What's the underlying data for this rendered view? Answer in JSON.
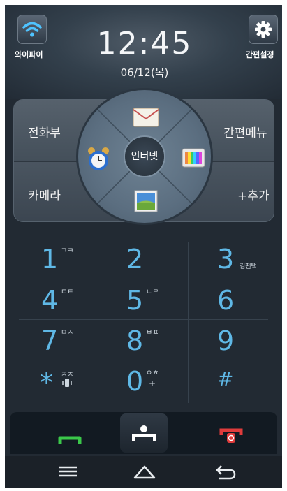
{
  "status": {
    "time": "12:45",
    "date": "06/12(목)"
  },
  "header": {
    "wifi_label": "와이파이",
    "settings_label": "간편설정"
  },
  "quick_menu": {
    "phonebook": "전화부",
    "quick_menu": "간편메뉴",
    "camera": "카메라",
    "add": "+추가",
    "internet": "인터넷",
    "wheel_icons": [
      "mail-icon",
      "tv-icon",
      "gallery-icon",
      "alarm-icon"
    ]
  },
  "keypad": {
    "keys": [
      {
        "digit": "1",
        "sub": "ㄱㅋ"
      },
      {
        "digit": "2",
        "sub": ""
      },
      {
        "digit": "3",
        "sub": "김팬택"
      },
      {
        "digit": "4",
        "sub": "ㄷㅌ"
      },
      {
        "digit": "5",
        "sub": "ㄴㄹ"
      },
      {
        "digit": "6",
        "sub": ""
      },
      {
        "digit": "7",
        "sub": "ㅁㅅ"
      },
      {
        "digit": "8",
        "sub": "ㅂㅍ"
      },
      {
        "digit": "9",
        "sub": ""
      },
      {
        "digit": "*",
        "sub": "ㅈㅊ"
      },
      {
        "digit": "0",
        "sub": "ㅇㅎ"
      },
      {
        "digit": "#",
        "sub": ""
      }
    ],
    "zero_extra": "+"
  },
  "colors": {
    "digit": "#5fb8e6",
    "call_green": "#3bc84a",
    "call_red": "#e03c3c",
    "background": "#222a33"
  },
  "call_bar": {
    "icons": [
      "call-icon",
      "contact-icon",
      "end-call-icon"
    ]
  },
  "nav": {
    "icons": [
      "menu-icon",
      "home-icon",
      "back-icon"
    ]
  }
}
